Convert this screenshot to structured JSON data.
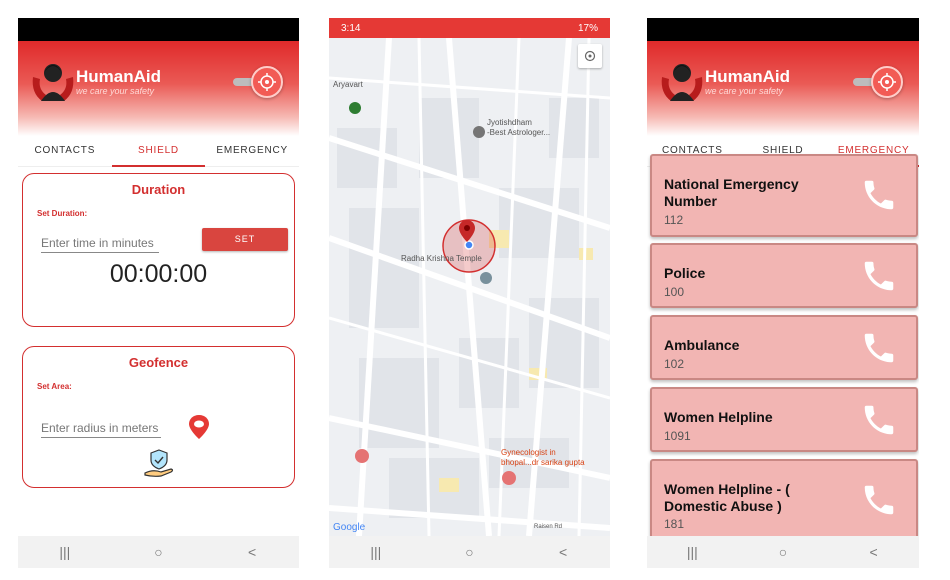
{
  "app": {
    "title": "HumanAid",
    "subtitle": "we care your safety"
  },
  "tabs": [
    "CONTACTS",
    "SHIELD",
    "EMERGENCY"
  ],
  "shield": {
    "duration": {
      "title": "Duration",
      "label": "Set Duration:",
      "placeholder": "Enter time in minutes",
      "button": "SET",
      "timer": "00:00:00"
    },
    "geofence": {
      "title": "Geofence",
      "label": "Set Area:",
      "placeholder": "Enter radius in meters"
    }
  },
  "status": {
    "time": "3:14",
    "battery": "17%"
  },
  "map": {
    "places": [
      "Aryavart",
      "Jyotishdham",
      "-Best Astrologer...",
      "Radha Krishna Temple",
      "Gynecologist in",
      "bhopal...dr sarika gupta",
      "Raisen Rd"
    ],
    "brand": "Google"
  },
  "emergency": [
    {
      "name": "National Emergency Number",
      "number": "112"
    },
    {
      "name": "Police",
      "number": "100"
    },
    {
      "name": "Ambulance",
      "number": "102"
    },
    {
      "name": "Women Helpline",
      "number": "1091"
    },
    {
      "name": "Women Helpline - ( Domestic Abuse )",
      "number": "181"
    }
  ],
  "nav": {
    "recents": "|||",
    "home": "○",
    "back": "<"
  },
  "colors": {
    "accent": "#d32f2f",
    "card": "#f2b5b3"
  }
}
